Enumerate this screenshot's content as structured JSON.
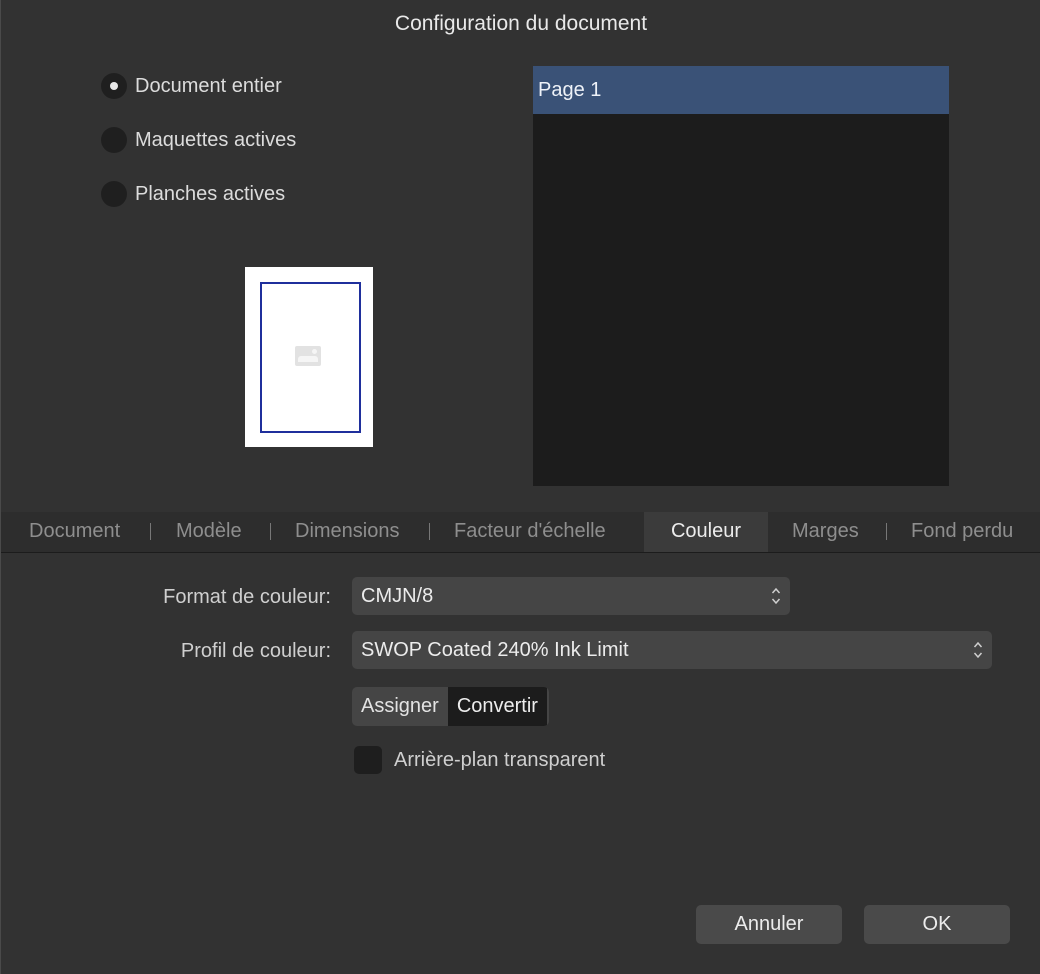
{
  "dialog": {
    "title": "Configuration du document"
  },
  "scope_options": [
    {
      "label": "Document entier",
      "selected": true
    },
    {
      "label": "Maquettes actives",
      "selected": false
    },
    {
      "label": "Planches actives",
      "selected": false
    }
  ],
  "pages": [
    {
      "label": "Page 1",
      "selected": true
    }
  ],
  "tabs": [
    {
      "label": "Document",
      "active": false
    },
    {
      "label": "Modèle",
      "active": false
    },
    {
      "label": "Dimensions",
      "active": false
    },
    {
      "label": "Facteur d'échelle",
      "active": false
    },
    {
      "label": "Couleur",
      "active": true
    },
    {
      "label": "Marges",
      "active": false
    },
    {
      "label": "Fond perdu",
      "active": false
    }
  ],
  "color": {
    "format_label": "Format de couleur:",
    "format_value": "CMJN/8",
    "profile_label": "Profil de couleur:",
    "profile_value": "SWOP Coated 240% Ink Limit",
    "mode_buttons": [
      {
        "label": "Assigner",
        "active": false
      },
      {
        "label": "Convertir",
        "active": true
      }
    ],
    "transparent_label": "Arrière-plan transparent",
    "transparent_checked": false
  },
  "footer": {
    "cancel_label": "Annuler",
    "ok_label": "OK"
  },
  "colors": {
    "selection": "#3a5277",
    "margin_guide": "#1f2f9c"
  }
}
